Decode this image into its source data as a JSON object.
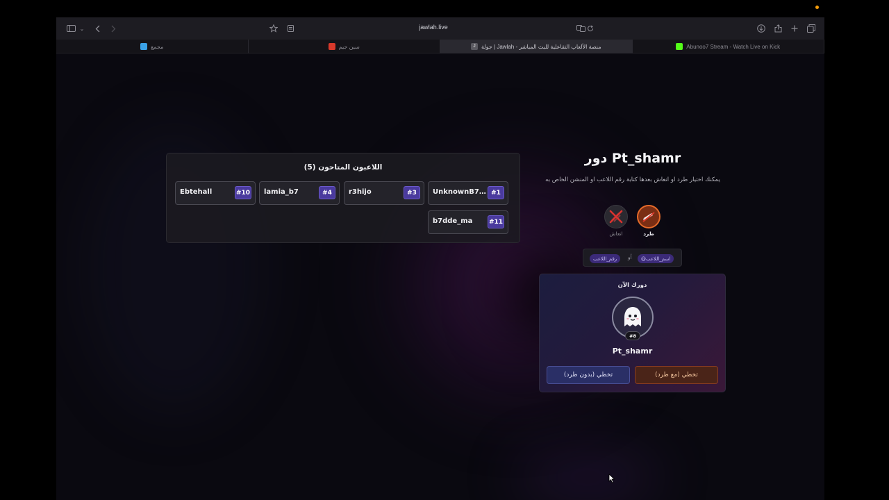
{
  "browser": {
    "url": "jawlah.live",
    "tabs": [
      {
        "label": "مجمع",
        "favicon_color": "#3aa1e6",
        "active": false
      },
      {
        "label": "سين جيم",
        "favicon_color": "#d8392b",
        "active": false
      },
      {
        "label": "جولة | Jawlah - منصة الألعاب التفاعلية للبث المباشر",
        "favicon_color": "#8a8990",
        "favicon_letter": "J",
        "active": true
      },
      {
        "label": "Abunoo7 Stream - Watch Live on Kick",
        "favicon_color": "#53fc18",
        "active": false
      }
    ],
    "icons": {
      "sidebar": "sidebar-icon",
      "sidebar_menu": "chevron-down-icon",
      "back": "chevron-left-icon",
      "forward": "chevron-right-icon",
      "bookmark": "star-icon",
      "page_settings": "page-icon",
      "translate": "translate-icon",
      "reload": "reload-icon",
      "downloads": "download-icon",
      "share": "share-icon",
      "new_tab": "plus-icon",
      "tab_overview": "tabs-icon"
    }
  },
  "players_panel": {
    "title": "اللاعبون المتاحون (5)",
    "players": [
      {
        "number": "#1",
        "name": "UnknownB7p..."
      },
      {
        "number": "#3",
        "name": "r3hijo"
      },
      {
        "number": "#4",
        "name": "lamia_b7"
      },
      {
        "number": "#10",
        "name": "Ebtehall"
      },
      {
        "number": "#11",
        "name": "b7dde_ma"
      }
    ]
  },
  "turn": {
    "title": "دور Pt_shamr",
    "instructions": "يمكنك اختيار طرد او انعاش بعدها كتابة رقم اللاعب او المنشن الخاص به",
    "actions": {
      "kick_label": "طرد",
      "revive_label": "انعاش"
    },
    "hint": {
      "mention_chip": "@اسم_اللاعب",
      "or_text": "أو",
      "number_chip": "رقم_اللاعب"
    },
    "card": {
      "now_label": "دورك الآن",
      "player_name": "Pt_shamr",
      "player_number": "#8",
      "skip_with_kick": "تخطي (مع طرد)",
      "skip_without_kick": "تخطي (بدون طرد)"
    }
  },
  "colors": {
    "accent_purple": "#4a3a9e",
    "kick_orange": "#e46a2a",
    "skip_blue": "#2a2f66"
  }
}
